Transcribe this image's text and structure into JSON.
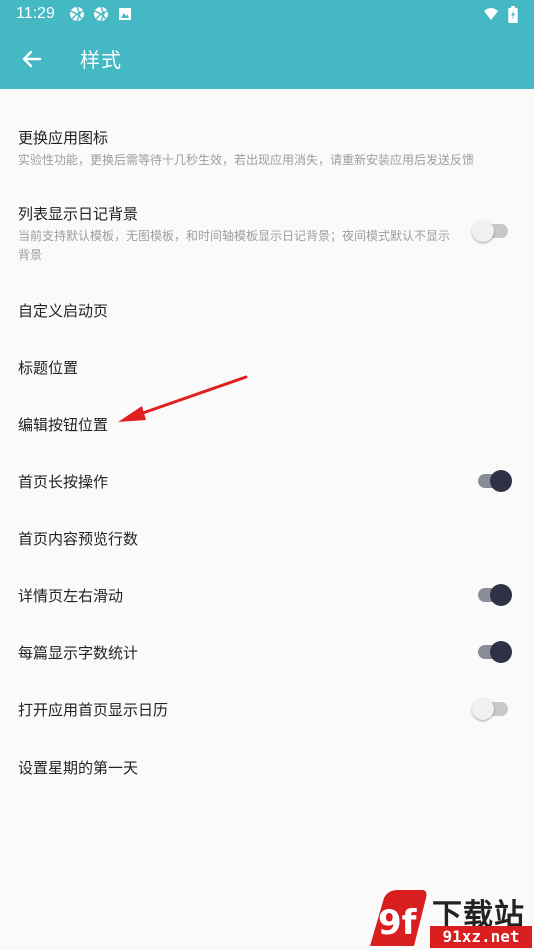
{
  "status_bar": {
    "time": "11:29",
    "left_icons": [
      "aperture-icon",
      "aperture-icon",
      "image-icon"
    ],
    "right_icons": [
      "wifi-icon",
      "battery-charging-icon"
    ]
  },
  "app_bar": {
    "title": "样式",
    "back_icon": "arrow-left-icon",
    "color": "#44b9c4"
  },
  "settings": [
    {
      "title": "更换应用图标",
      "subtitle": "实验性功能，更换后需等待十几秒生效，若出现应用消失，请重新安装应用后发送反馈"
    },
    {
      "title": "列表显示日记背景",
      "subtitle": "当前支持默认模板，无图模板，和时间轴模板显示日记背景；夜间模式默认不显示背景",
      "toggle": false
    },
    {
      "title": "自定义启动页"
    },
    {
      "title": "标题位置"
    },
    {
      "title": "编辑按钮位置"
    },
    {
      "title": "首页长按操作",
      "toggle": true
    },
    {
      "title": "首页内容预览行数"
    },
    {
      "title": "详情页左右滑动",
      "toggle": true
    },
    {
      "title": "每篇显示字数统计",
      "toggle": true
    },
    {
      "title": "打开应用首页显示日历",
      "toggle": false
    },
    {
      "title": "设置星期的第一天"
    }
  ],
  "annotation": {
    "color": "#e0201f"
  },
  "watermark": {
    "logo_text": "9f",
    "top": "下载站",
    "bottom": "91xz.net"
  }
}
